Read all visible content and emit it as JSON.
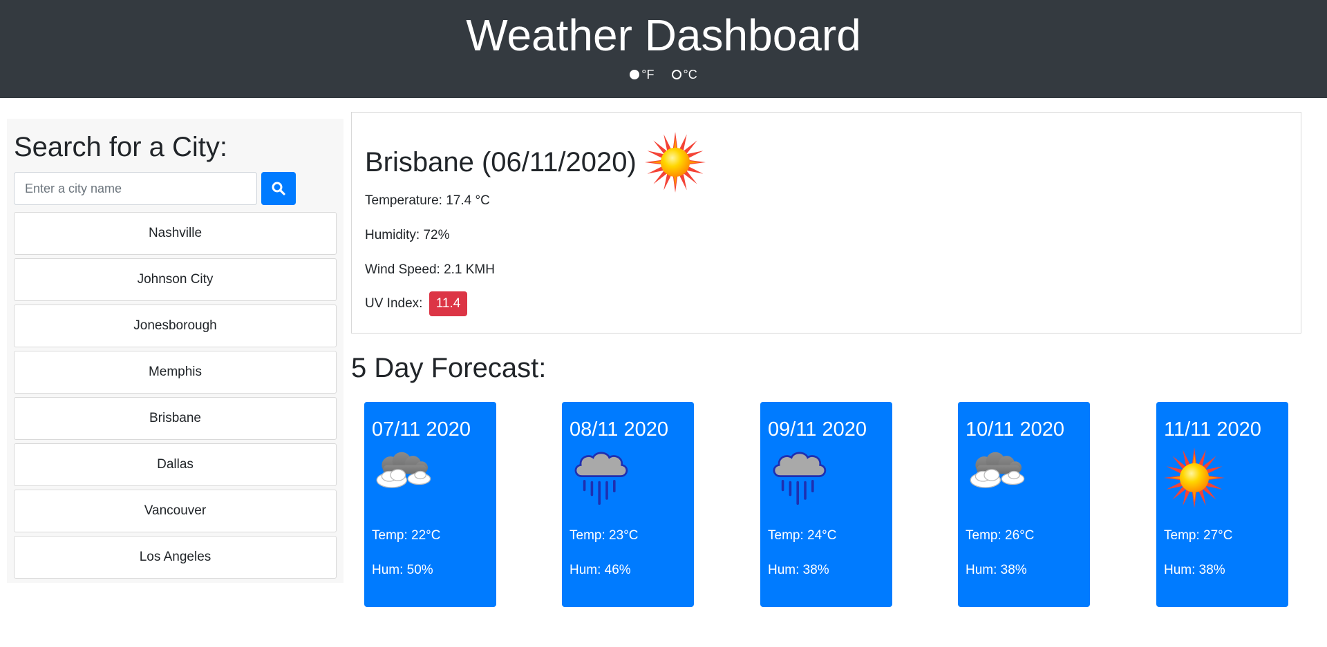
{
  "header": {
    "title": "Weather Dashboard",
    "unit_f_label": "°F",
    "unit_c_label": "°C",
    "selected_unit": "°F"
  },
  "search": {
    "heading": "Search for a City:",
    "placeholder": "Enter a city name",
    "button_icon": "search-icon"
  },
  "cities": [
    "Nashville",
    "Johnson City",
    "Jonesborough",
    "Memphis",
    "Brisbane",
    "Dallas",
    "Vancouver",
    "Los Angeles"
  ],
  "current": {
    "title": "Brisbane (06/11/2020)",
    "icon": "sun-icon",
    "temperature": "Temperature: 17.4 °C",
    "humidity": "Humidity: 72%",
    "wind": "Wind Speed: 2.1 KMH",
    "uv_label": "UV Index:",
    "uv_value": "11.4"
  },
  "forecast": {
    "title": "5 Day Forecast:",
    "days": [
      {
        "date": "07/11 2020",
        "icon": "partly-cloudy-icon",
        "temp": "Temp: 22°C",
        "hum": "Hum: 50%"
      },
      {
        "date": "08/11 2020",
        "icon": "rain-icon",
        "temp": "Temp: 23°C",
        "hum": "Hum: 46%"
      },
      {
        "date": "09/11 2020",
        "icon": "rain-icon",
        "temp": "Temp: 24°C",
        "hum": "Hum: 38%"
      },
      {
        "date": "10/11 2020",
        "icon": "partly-cloudy-icon",
        "temp": "Temp: 26°C",
        "hum": "Hum: 38%"
      },
      {
        "date": "11/11 2020",
        "icon": "sun-icon",
        "temp": "Temp: 27°C",
        "hum": "Hum: 38%"
      }
    ]
  },
  "colors": {
    "header_bg": "#343a40",
    "primary": "#007bff",
    "uv_badge": "#dc3545"
  }
}
